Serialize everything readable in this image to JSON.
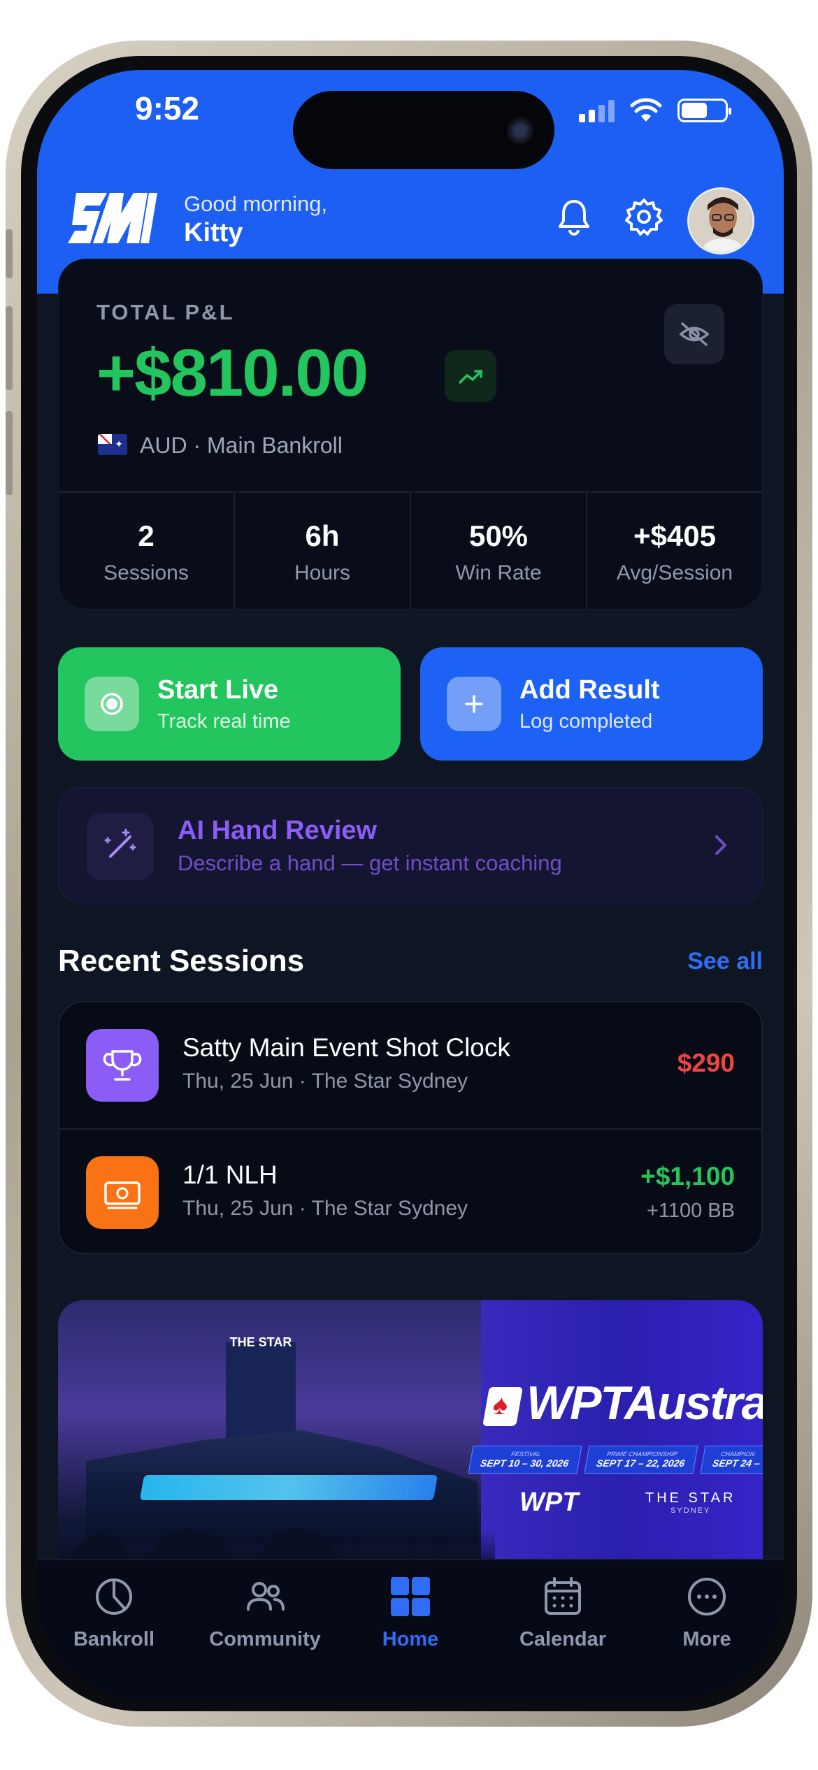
{
  "status_bar": {
    "time": "9:52"
  },
  "header": {
    "greeting": "Good morning,",
    "user_name": "Kitty"
  },
  "pl_card": {
    "label": "TOTAL P&L",
    "value": "+$810.00",
    "currency_line": "AUD · Main Bankroll",
    "stats": [
      {
        "value": "2",
        "label": "Sessions"
      },
      {
        "value": "6h",
        "label": "Hours"
      },
      {
        "value": "50%",
        "label": "Win Rate"
      },
      {
        "value": "+$405",
        "label": "Avg/Session"
      }
    ]
  },
  "actions": {
    "start_live": {
      "title": "Start Live",
      "subtitle": "Track real time"
    },
    "add_result": {
      "title": "Add Result",
      "subtitle": "Log completed"
    }
  },
  "ai_review": {
    "title": "AI Hand Review",
    "subtitle": "Describe a hand — get instant coaching"
  },
  "recent_sessions": {
    "title": "Recent Sessions",
    "see_all": "See all",
    "items": [
      {
        "name": "Satty Main Event Shot Clock",
        "meta": "Thu, 25 Jun · The Star Sydney",
        "amount": "$290",
        "icon": "trophy-icon"
      },
      {
        "name": "1/1 NLH",
        "meta": "Thu, 25 Jun · The Star Sydney",
        "amount": "+$1,100",
        "sub_amount": "+1100 BB",
        "icon": "cash-icon"
      }
    ]
  },
  "banner": {
    "tower_label": "THE STAR",
    "title": "WPTAustrali",
    "dates": [
      {
        "caption": "FESTIVAL",
        "range": "SEPT 10 – 30, 2026"
      },
      {
        "caption": "PRIME CHAMPIONSHIP",
        "range": "SEPT 17 – 22, 2026"
      },
      {
        "caption": "CHAMPION",
        "range": "SEPT 24 –"
      }
    ],
    "sponsor_wpt": "WPT",
    "sponsor_star": "THE STAR",
    "sponsor_star_city": "SYDNEY"
  },
  "tabbar": {
    "tabs": [
      {
        "label": "Bankroll",
        "icon": "pie-chart-icon"
      },
      {
        "label": "Community",
        "icon": "people-icon"
      },
      {
        "label": "Home",
        "icon": "grid-icon",
        "active": true
      },
      {
        "label": "Calendar",
        "icon": "calendar-icon"
      },
      {
        "label": "More",
        "icon": "more-icon"
      }
    ]
  },
  "colors": {
    "brand_blue": "#1d5ff2",
    "profit_green": "#22c55e",
    "loss_red": "#ef4444",
    "ai_purple": "#8b5cf6",
    "background": "#0e1624"
  }
}
